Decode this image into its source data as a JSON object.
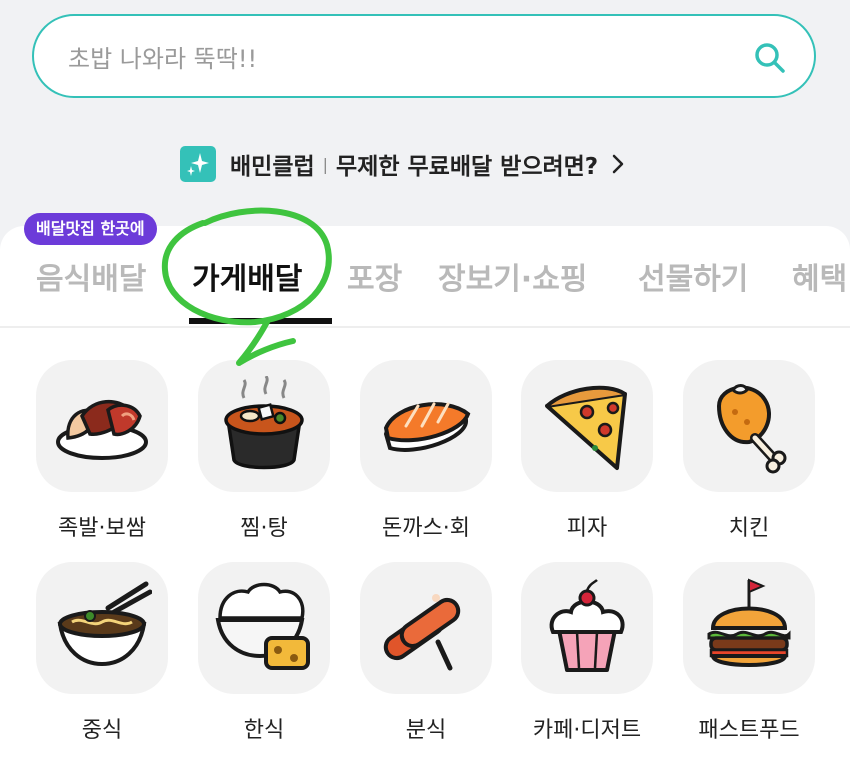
{
  "search": {
    "placeholder": "초밥 나와라 뚝딱!!"
  },
  "club_banner": {
    "name": "배민클럽",
    "divider": "|",
    "promo": "무제한 무료배달 받으려면?"
  },
  "tabs": {
    "badge": "배달맛집 한곳에",
    "items": [
      {
        "label": "음식배달",
        "active": false
      },
      {
        "label": "가게배달",
        "active": true
      },
      {
        "label": "포장",
        "active": false
      },
      {
        "label": "장보기·쇼핑",
        "active": false
      },
      {
        "label": "선물하기",
        "active": false
      },
      {
        "label": "혜택",
        "active": false
      }
    ]
  },
  "categories": [
    {
      "label": "족발·보쌈",
      "icon": "jokbal-icon"
    },
    {
      "label": "찜·탕",
      "icon": "stew-pot-icon"
    },
    {
      "label": "돈까스·회",
      "icon": "sushi-icon"
    },
    {
      "label": "피자",
      "icon": "pizza-icon"
    },
    {
      "label": "치킨",
      "icon": "chicken-leg-icon"
    },
    {
      "label": "중식",
      "icon": "noodle-bowl-icon"
    },
    {
      "label": "한식",
      "icon": "rice-bowl-icon"
    },
    {
      "label": "분식",
      "icon": "tteokbokki-icon"
    },
    {
      "label": "카페·디저트",
      "icon": "cupcake-icon"
    },
    {
      "label": "패스트푸드",
      "icon": "burger-icon"
    }
  ],
  "colors": {
    "accent": "#34c1b8",
    "badge": "#6c3bd9",
    "annotation": "#3fc43f",
    "tab_inactive": "#b9b9b9",
    "tab_active": "#111111"
  }
}
